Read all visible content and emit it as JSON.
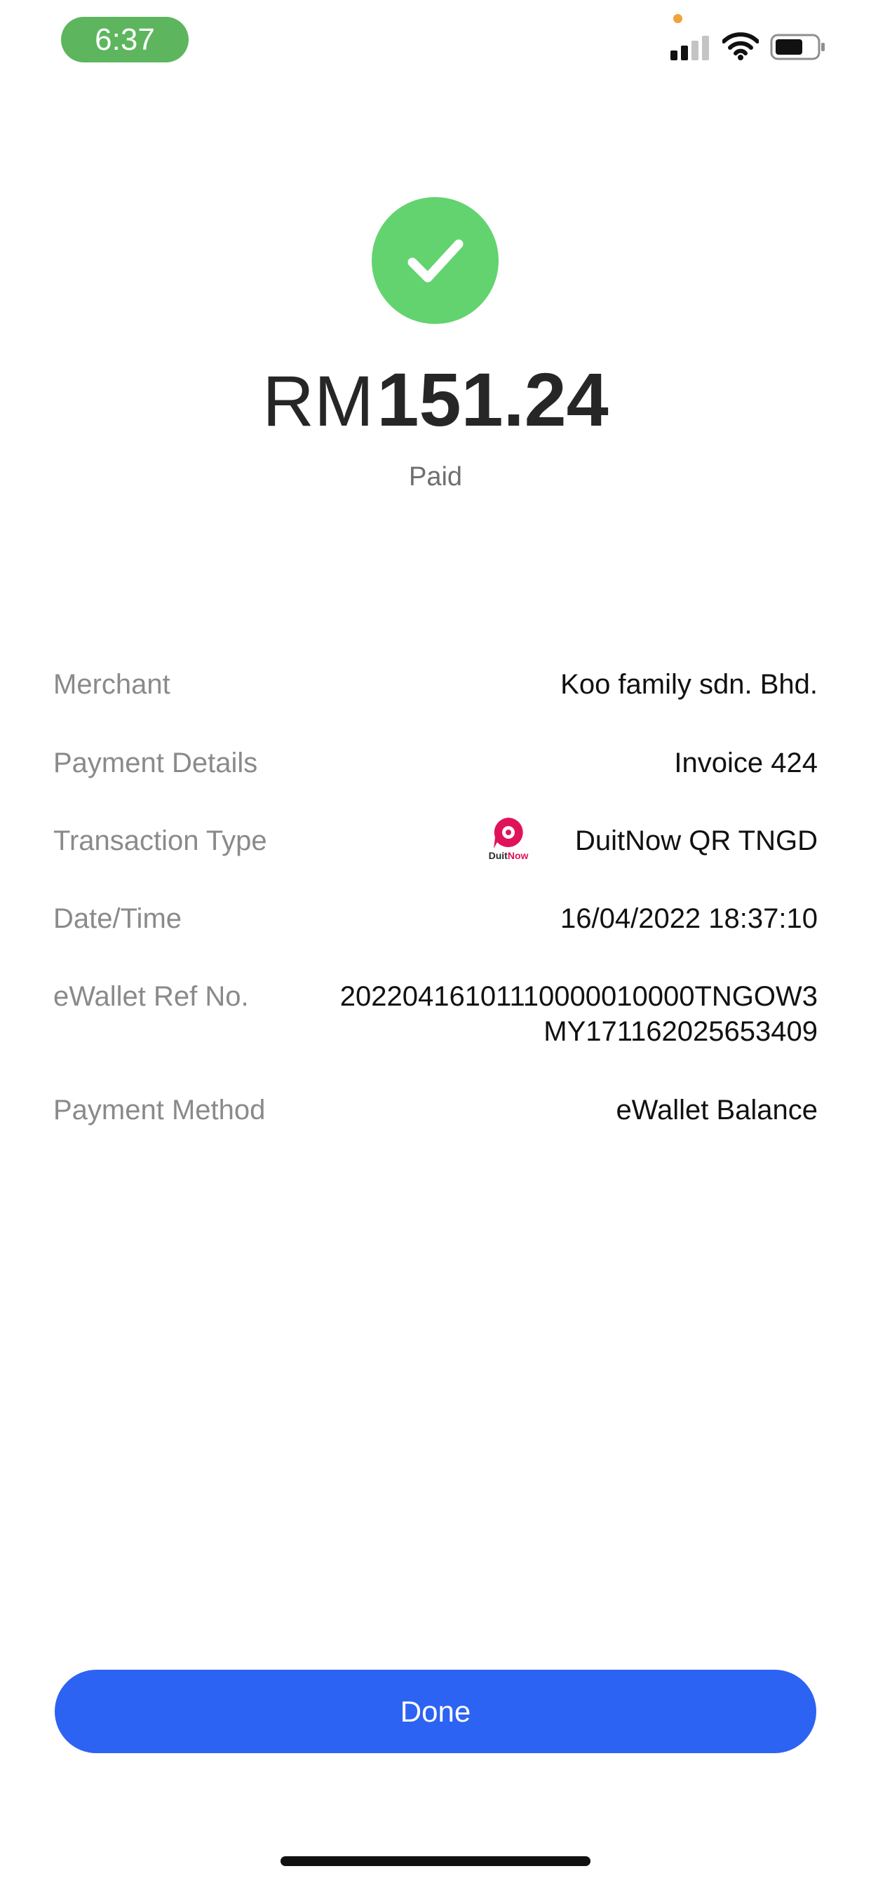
{
  "status_bar": {
    "time": "6:37",
    "colors": {
      "time_pill": "#5db55e",
      "privacy_dot": "#f0a23b"
    }
  },
  "header": {
    "currency": "RM",
    "amount": "151.24",
    "status": "Paid",
    "colors": {
      "check": "#63d36f"
    }
  },
  "details": {
    "merchant": {
      "label": "Merchant",
      "value": "Koo family sdn. Bhd."
    },
    "payment_details": {
      "label": "Payment Details",
      "value": "Invoice 424"
    },
    "transaction_type": {
      "label": "Transaction Type",
      "value": "DuitNow QR TNGD",
      "logo_text_duit": "Duit",
      "logo_text_now": "Now"
    },
    "datetime": {
      "label": "Date/Time",
      "value": "16/04/2022 18:37:10"
    },
    "ref_no": {
      "label": "eWallet Ref No.",
      "value_line1": "20220416101110000010000TNGOW3",
      "value_line2": "MY171162025653409"
    },
    "payment_method": {
      "label": "Payment Method",
      "value": "eWallet Balance"
    }
  },
  "done_button": {
    "label": "Done",
    "color": "#2d63f2"
  }
}
